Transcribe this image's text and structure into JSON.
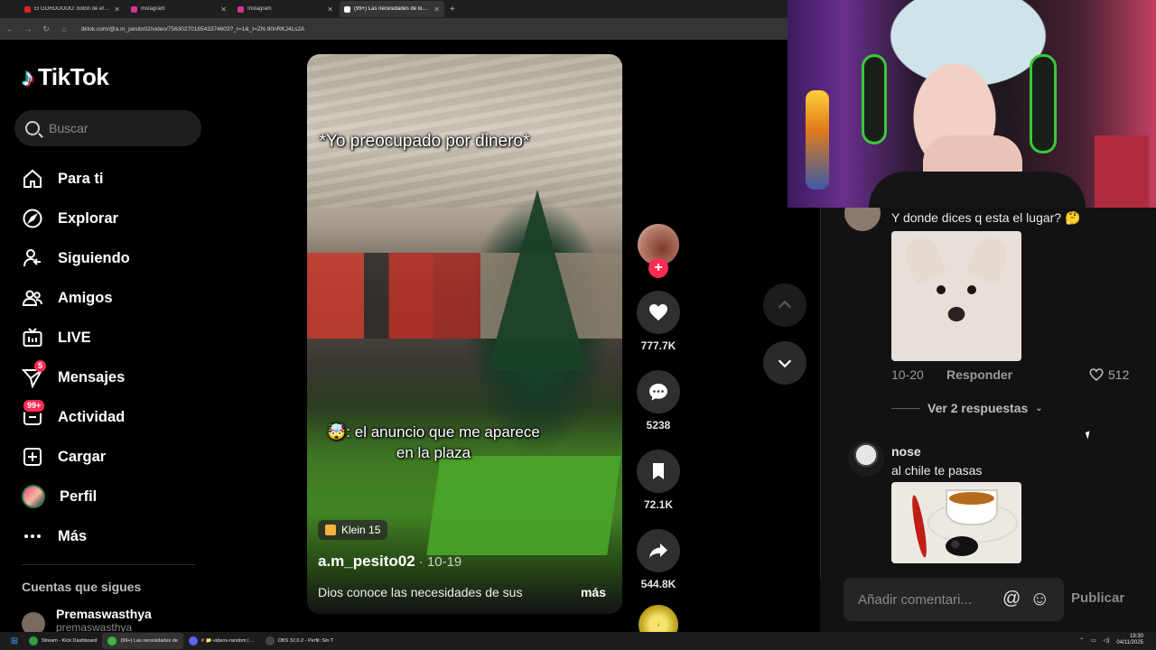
{
  "browser": {
    "tabs": [
      {
        "label": "El GORDOOOO: botón de efecto",
        "fav_color": "#e02020",
        "active": false
      },
      {
        "label": "Instagram",
        "fav_color": "#d6338f",
        "active": false
      },
      {
        "label": "Instagram",
        "fav_color": "#d6338f",
        "active": false
      },
      {
        "label": "(99+) Las necesidades de los gu",
        "fav_color": "#ffffff",
        "active": true
      }
    ],
    "new_tab": "+",
    "url": "tiktok.com/@a.m_pesito02/video/7563027016543374603?_r=1&_t=ZN-90nRKJ4Ls2A"
  },
  "sidebar": {
    "logo_text": "TikTok",
    "search_placeholder": "Buscar",
    "nav": [
      {
        "label": "Para ti",
        "icon": "home-icon"
      },
      {
        "label": "Explorar",
        "icon": "compass-icon"
      },
      {
        "label": "Siguiendo",
        "icon": "following-icon"
      },
      {
        "label": "Amigos",
        "icon": "friends-icon"
      },
      {
        "label": "LIVE",
        "icon": "live-icon"
      },
      {
        "label": "Mensajes",
        "icon": "messages-icon",
        "badge": "5"
      },
      {
        "label": "Actividad",
        "icon": "activity-icon",
        "badge": "99+"
      },
      {
        "label": "Cargar",
        "icon": "upload-icon"
      },
      {
        "label": "Perfil",
        "icon": "avatar"
      },
      {
        "label": "Más",
        "icon": "more-icon"
      }
    ],
    "following_title": "Cuentas que sigues",
    "following": [
      {
        "name": "Premaswasthya",
        "handle": "premaswasthya"
      }
    ]
  },
  "video": {
    "caption_top": "*Yo preocupado por dinero*",
    "caption_bottom": "🤯: el anuncio que me aparece en la plaza",
    "music": "Klein 15",
    "author": "a.m_pesito02",
    "date": "· 10-19",
    "description": "Dios conoce las necesidades de sus",
    "more": "más"
  },
  "actions": {
    "likes": "777.7K",
    "comments": "5238",
    "saves": "72.1K",
    "shares": "544.8K",
    "follow": "+"
  },
  "comments": {
    "items": [
      {
        "user": "",
        "text": "Y donde dices q esta el lugar? 🤔",
        "date": "10-20",
        "reply": "Responder",
        "likes": "512",
        "view_replies": "Ver 2 respuestas"
      },
      {
        "user": "nose",
        "text": "al chile te pasas"
      }
    ],
    "input_placeholder": "Añadir comentari...",
    "mention": "@",
    "emoji": "☺",
    "publish": "Publicar"
  },
  "taskbar": {
    "items": [
      {
        "label": "Stream - Kick Dashboard",
        "color": "#2ea043",
        "active": false
      },
      {
        "label": "(99+) Las necesidades de",
        "color": "#3ab54a",
        "active": true
      },
      {
        "label": "# 📁-videos-random | ...",
        "color": "#5865f2",
        "active": false
      },
      {
        "label": "OBS 32.0.2 - Perfil: Sin T",
        "color": "#444444",
        "active": false
      }
    ],
    "time": "19:30",
    "date": "04/11/2025"
  }
}
